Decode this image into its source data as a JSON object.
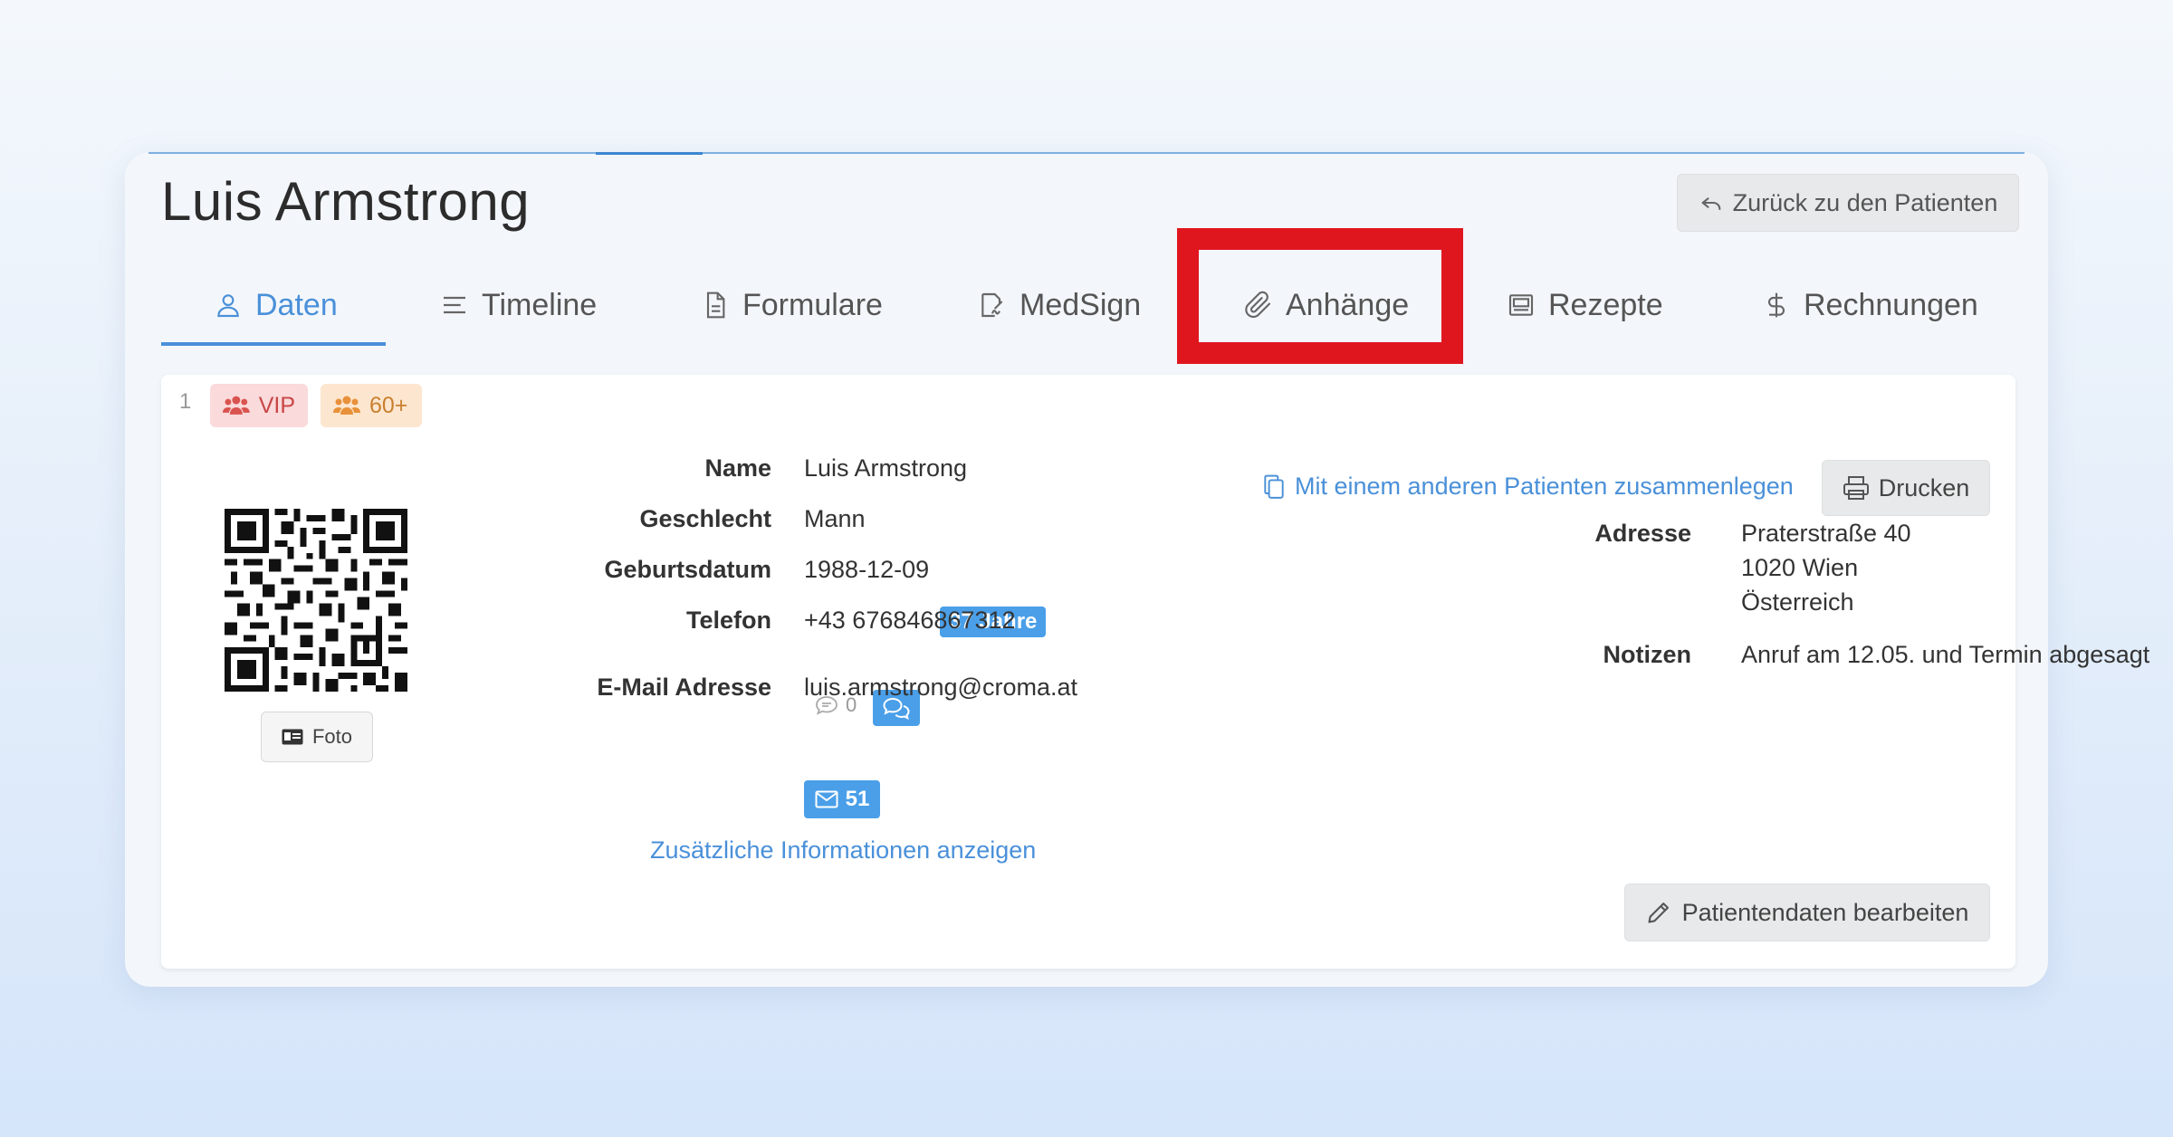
{
  "header": {
    "title": "Luis Armstrong",
    "back_label": "Zurück zu den Patienten"
  },
  "tabs": [
    {
      "label": "Daten",
      "icon": "user-icon",
      "active": true
    },
    {
      "label": "Timeline",
      "icon": "list-icon",
      "active": false
    },
    {
      "label": "Formulare",
      "icon": "document-icon",
      "active": false
    },
    {
      "label": "MedSign",
      "icon": "signature-icon",
      "active": false
    },
    {
      "label": "Anhänge",
      "icon": "paperclip-icon",
      "active": false,
      "highlighted": true
    },
    {
      "label": "Rezepte",
      "icon": "prescription-icon",
      "active": false
    },
    {
      "label": "Rechnungen",
      "icon": "dollar-icon",
      "active": false
    }
  ],
  "panel": {
    "row_number": "1",
    "badges": [
      {
        "label": "VIP",
        "icon": "users-icon",
        "color": "#c94646",
        "background": "#fadadb"
      },
      {
        "label": "60+",
        "icon": "users-icon",
        "color": "#c9802e",
        "background": "#fde6cf"
      }
    ],
    "foto_label": "Foto",
    "fields": {
      "name_label": "Name",
      "name_value": "Luis Armstrong",
      "gender_label": "Geschlecht",
      "gender_value": "Mann",
      "birthdate_label": "Geburtsdatum",
      "birthdate_value": "1988-12-09",
      "age_badge": "37 Jahre",
      "phone_label": "Telefon",
      "phone_value": "+43 676846867312",
      "sms_count": "0",
      "email_label": "E-Mail Adresse",
      "email_value": "luis.armstrong@croma.at",
      "email_count": "51"
    },
    "more_info_link": "Zusätzliche Informationen anzeigen",
    "merge_link": "Mit einem anderen Patienten zusammenlegen",
    "print_label": "Drucken",
    "address_label": "Adresse",
    "address_lines": [
      "Praterstraße 40",
      "1020 Wien",
      "Österreich"
    ],
    "notes_label": "Notizen",
    "notes_value": "Anruf am 12.05. und Termin abgesagt",
    "edit_label": "Patientendaten bearbeiten"
  },
  "colors": {
    "accent": "#4a90d9",
    "badge_blue": "#4a9fe8",
    "highlight_red": "#e0161f"
  }
}
